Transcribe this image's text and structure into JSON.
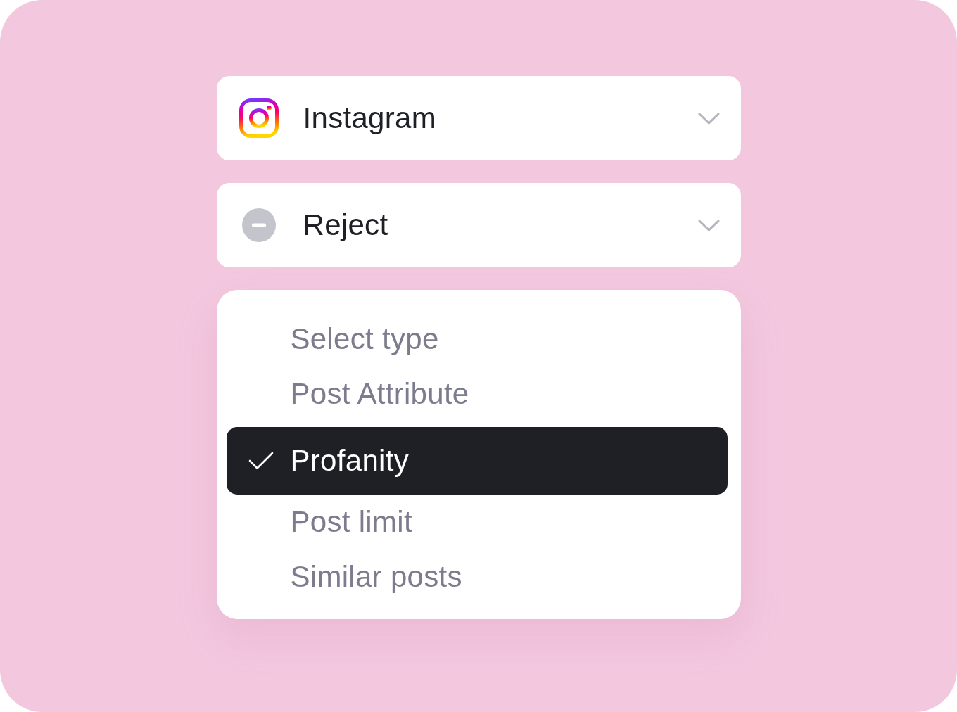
{
  "selects": [
    {
      "kind": "platform",
      "value": "Instagram"
    },
    {
      "kind": "action",
      "value": "Reject"
    }
  ],
  "menu": {
    "items": [
      {
        "label": "Select type",
        "selected": false
      },
      {
        "label": "Post Attribute",
        "selected": false
      },
      {
        "label": "Profanity",
        "selected": true
      },
      {
        "label": "Post limit",
        "selected": false
      },
      {
        "label": "Similar posts",
        "selected": false
      }
    ]
  }
}
